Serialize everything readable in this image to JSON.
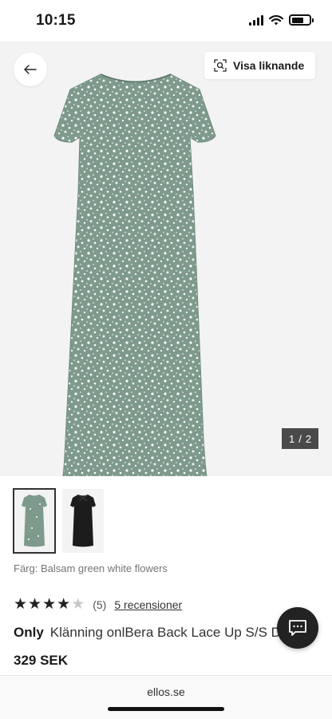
{
  "status_bar": {
    "time": "10:15",
    "icons": [
      "signal-icon",
      "wifi-icon",
      "battery-icon"
    ]
  },
  "hero": {
    "back_icon": "arrow-left-icon",
    "similar": {
      "icon": "visual-search-icon",
      "label": "Visa liknande"
    },
    "counter": {
      "current": "1",
      "separator": "/",
      "total": "2"
    }
  },
  "thumbnails": [
    {
      "name": "green-floral-dress",
      "selected": true
    },
    {
      "name": "black-dress",
      "selected": false
    }
  ],
  "product": {
    "color_line": "Färg: Balsam green white flowers",
    "rating": {
      "value": 4,
      "max": 5,
      "count_text": "(5)",
      "reviews_link": "5 recensioner"
    },
    "brand": "Only",
    "name": "Klänning onlBera Back Lace Up S/S D",
    "price": "329 SEK"
  },
  "chat_icon": "chat-bubble-icon",
  "browser": {
    "url": "ellos.se"
  },
  "colors": {
    "accent": "#222222",
    "dress_green": "#7e9a8c",
    "hero_bg": "#f3f3f3",
    "muted_text": "#767676"
  }
}
